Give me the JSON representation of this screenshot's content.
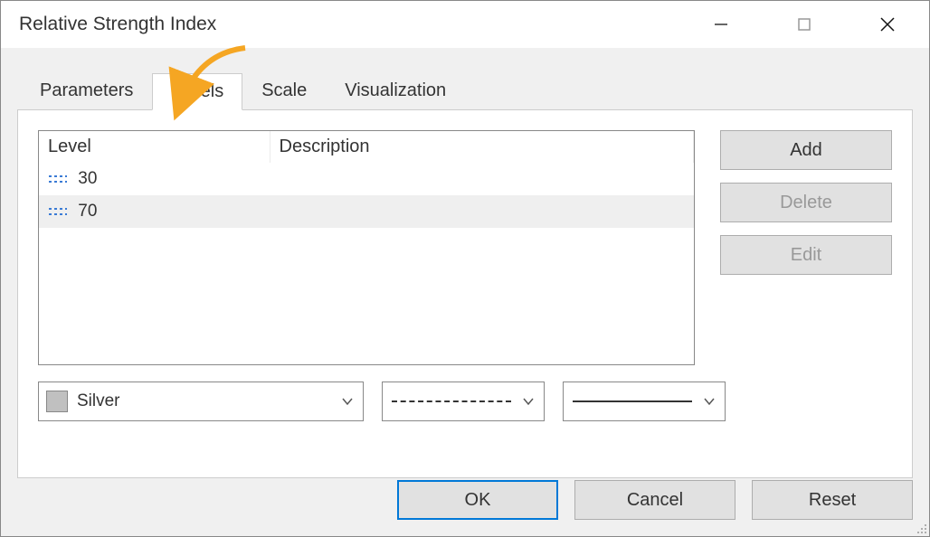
{
  "title": "Relative Strength Index",
  "tabs": {
    "parameters": "Parameters",
    "levels": "Levels",
    "scale": "Scale",
    "visualization": "Visualization",
    "active": "levels"
  },
  "table": {
    "headers": {
      "level": "Level",
      "description": "Description"
    },
    "rows": [
      {
        "level": "30",
        "description": ""
      },
      {
        "level": "70",
        "description": ""
      }
    ]
  },
  "side": {
    "add": "Add",
    "delete": "Delete",
    "edit": "Edit"
  },
  "color_combo": {
    "name": "Silver",
    "swatch": "#c0c0c0"
  },
  "style_combo": {
    "value": "dashed"
  },
  "width_combo": {
    "value": "thin"
  },
  "footer": {
    "ok": "OK",
    "cancel": "Cancel",
    "reset": "Reset"
  }
}
